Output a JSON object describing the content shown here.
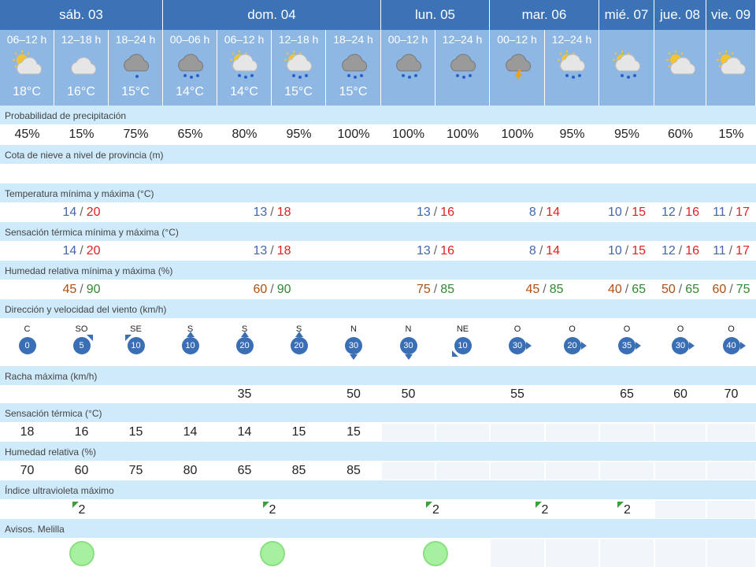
{
  "days": [
    {
      "label": "sáb. 03",
      "span": 3
    },
    {
      "label": "dom. 04",
      "span": 4
    },
    {
      "label": "lun. 05",
      "span": 2
    },
    {
      "label": "mar. 06",
      "span": 2
    },
    {
      "label": "mié. 07",
      "span": 1
    },
    {
      "label": "jue. 08",
      "span": 1
    },
    {
      "label": "vie. 09",
      "span": 1
    }
  ],
  "periods": [
    {
      "label": "06–12 h",
      "temp": "18°C",
      "icon": "sun-cloud-icon"
    },
    {
      "label": "12–18 h",
      "temp": "16°C",
      "icon": "cloud-icon"
    },
    {
      "label": "18–24 h",
      "temp": "15°C",
      "icon": "cloud-rain-light-icon"
    },
    {
      "label": "00–06 h",
      "temp": "14°C",
      "icon": "cloud-rain-icon"
    },
    {
      "label": "06–12 h",
      "temp": "14°C",
      "icon": "sun-cloud-rain-icon"
    },
    {
      "label": "12–18 h",
      "temp": "15°C",
      "icon": "sun-cloud-rain-icon"
    },
    {
      "label": "18–24 h",
      "temp": "15°C",
      "icon": "cloud-rain-icon"
    },
    {
      "label": "00–12 h",
      "temp": "",
      "icon": "cloud-rain-icon"
    },
    {
      "label": "12–24 h",
      "temp": "",
      "icon": "cloud-rain-icon"
    },
    {
      "label": "00–12 h",
      "temp": "",
      "icon": "cloud-storm-icon"
    },
    {
      "label": "12–24 h",
      "temp": "",
      "icon": "sun-cloud-rain-icon"
    },
    {
      "label": "",
      "temp": "",
      "icon": "sun-cloud-rain-icon"
    },
    {
      "label": "",
      "temp": "",
      "icon": "sun-cloud-icon"
    },
    {
      "label": "",
      "temp": "",
      "icon": "sun-cloud-icon"
    }
  ],
  "rows": {
    "precip": {
      "label": "Probabilidad de precipitación",
      "values": [
        "45%",
        "15%",
        "75%",
        "65%",
        "80%",
        "95%",
        "100%",
        "100%",
        "100%",
        "100%",
        "95%",
        "95%",
        "60%",
        "15%"
      ]
    },
    "snow": {
      "label": "Cota de nieve a nivel de provincia (m)"
    },
    "temp": {
      "label": "Temperatura mínima y máxima (°C)",
      "values": [
        {
          "min": "14",
          "max": "20",
          "span": 3
        },
        {
          "min": "13",
          "max": "18",
          "span": 4
        },
        {
          "min": "13",
          "max": "16",
          "span": 2
        },
        {
          "min": "8",
          "max": "14",
          "span": 2
        },
        {
          "min": "10",
          "max": "15",
          "span": 1
        },
        {
          "min": "12",
          "max": "16",
          "span": 1
        },
        {
          "min": "11",
          "max": "17",
          "span": 1
        }
      ]
    },
    "feel": {
      "label": "Sensación térmica mínima y máxima (°C)",
      "values": [
        {
          "min": "14",
          "max": "20",
          "span": 3
        },
        {
          "min": "13",
          "max": "18",
          "span": 4
        },
        {
          "min": "13",
          "max": "16",
          "span": 2
        },
        {
          "min": "8",
          "max": "14",
          "span": 2
        },
        {
          "min": "10",
          "max": "15",
          "span": 1
        },
        {
          "min": "12",
          "max": "16",
          "span": 1
        },
        {
          "min": "11",
          "max": "17",
          "span": 1
        }
      ]
    },
    "humidity": {
      "label": "Humedad relativa mínima y máxima (%)",
      "values": [
        {
          "min": "45",
          "max": "90",
          "span": 3
        },
        {
          "min": "60",
          "max": "90",
          "span": 4
        },
        {
          "min": "75",
          "max": "85",
          "span": 2
        },
        {
          "min": "45",
          "max": "85",
          "span": 2
        },
        {
          "min": "40",
          "max": "65",
          "span": 1
        },
        {
          "min": "50",
          "max": "65",
          "span": 1
        },
        {
          "min": "60",
          "max": "75",
          "span": 1
        }
      ]
    },
    "wind": {
      "label": "Dirección y velocidad del viento (km/h)",
      "values": [
        {
          "dir": "C",
          "speed": "0",
          "arrow": ""
        },
        {
          "dir": "SO",
          "speed": "5",
          "arrow": "a-ne"
        },
        {
          "dir": "SE",
          "speed": "10",
          "arrow": "a-nw"
        },
        {
          "dir": "S",
          "speed": "10",
          "arrow": "a-up"
        },
        {
          "dir": "S",
          "speed": "20",
          "arrow": "a-up"
        },
        {
          "dir": "S",
          "speed": "20",
          "arrow": "a-up"
        },
        {
          "dir": "N",
          "speed": "30",
          "arrow": "a-down"
        },
        {
          "dir": "N",
          "speed": "30",
          "arrow": "a-down"
        },
        {
          "dir": "NE",
          "speed": "10",
          "arrow": "a-sw"
        },
        {
          "dir": "O",
          "speed": "30",
          "arrow": "a-right"
        },
        {
          "dir": "O",
          "speed": "20",
          "arrow": "a-right"
        },
        {
          "dir": "O",
          "speed": "35",
          "arrow": "a-right"
        },
        {
          "dir": "O",
          "speed": "30",
          "arrow": "a-right"
        },
        {
          "dir": "O",
          "speed": "40",
          "arrow": "a-right"
        }
      ]
    },
    "gust": {
      "label": "Racha máxima (km/h)",
      "values": [
        "",
        "",
        "",
        "",
        "35",
        "",
        "50",
        "50",
        "",
        "55",
        "",
        "65",
        "60",
        "70"
      ]
    },
    "feel2": {
      "label": "Sensación térmica (°C)",
      "values": [
        "18",
        "16",
        "15",
        "14",
        "14",
        "15",
        "15"
      ]
    },
    "hum2": {
      "label": "Humedad relativa (%)",
      "values": [
        "70",
        "60",
        "75",
        "80",
        "65",
        "85",
        "85"
      ]
    },
    "uv": {
      "label": "Índice ultravioleta máximo",
      "values": [
        {
          "value": "2",
          "span": 3
        },
        {
          "value": "2",
          "span": 4
        },
        {
          "value": "2",
          "span": 2
        },
        {
          "value": "2",
          "span": 2
        },
        {
          "value": "2",
          "span": 1
        }
      ]
    },
    "avisos": {
      "label": "Avisos. Melilla"
    }
  },
  "colors": {
    "day_header": "#3c73b6",
    "period_header": "#8fb7e3",
    "label_row": "#cfeafb",
    "temp_min": "#4467a8",
    "temp_max": "#e02020",
    "aviso_green": "#a7f0a0"
  }
}
